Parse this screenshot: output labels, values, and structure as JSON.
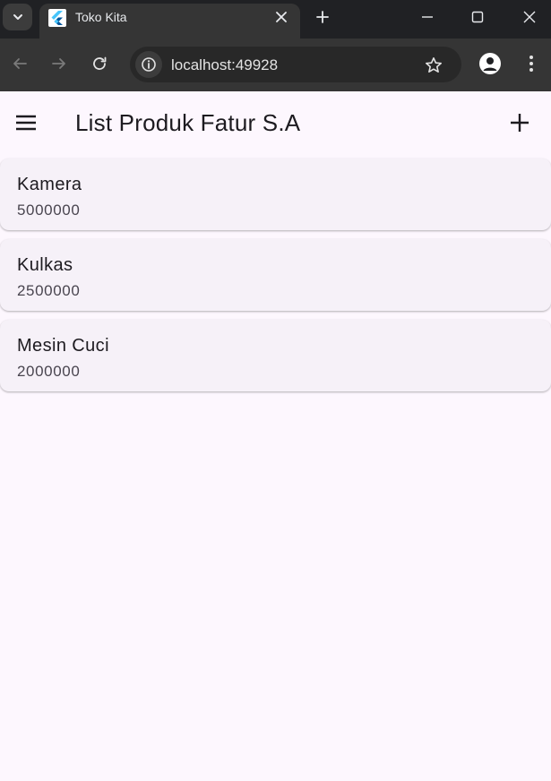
{
  "browser": {
    "tab_title": "Toko Kita",
    "url": "localhost:49928"
  },
  "app": {
    "title": "List Produk Fatur S.A",
    "products": [
      {
        "name": "Kamera",
        "price": "5000000"
      },
      {
        "name": "Kulkas",
        "price": "2500000"
      },
      {
        "name": "Mesin Cuci",
        "price": "2000000"
      }
    ]
  },
  "colors": {
    "background": "#fdf7fe",
    "card": "#f6f1f8",
    "chrome_dark": "#202124",
    "chrome_toolbar": "#353535"
  },
  "icons": {
    "tab_search": "chevron-down-icon",
    "favicon": "flutter-icon",
    "tab_close": "close-icon",
    "new_tab": "plus-icon",
    "minimize": "minimize-icon",
    "maximize": "maximize-icon",
    "window_close": "close-icon",
    "back": "arrow-left-icon",
    "forward": "arrow-right-icon",
    "reload": "reload-icon",
    "site_info": "info-icon",
    "bookmark": "star-icon",
    "profile": "person-icon",
    "browser_menu": "kebab-icon",
    "drawer": "hamburger-menu-icon",
    "add": "plus-icon"
  }
}
